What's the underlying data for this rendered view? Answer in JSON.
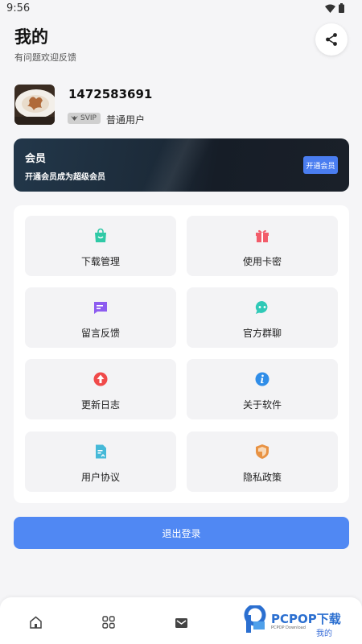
{
  "status_bar": {
    "time": "9:56"
  },
  "header": {
    "title": "我的",
    "subtitle": "有问题欢迎反馈"
  },
  "profile": {
    "username": "1472583691",
    "badge": "SVIP",
    "user_type": "普通用户"
  },
  "member": {
    "title": "会员",
    "description": "开通会员成为超级会员",
    "button_label": "开通会员"
  },
  "menu": {
    "items": [
      {
        "label": "下载管理",
        "icon": "shopping-bag-icon",
        "color": "#2fc9a6"
      },
      {
        "label": "使用卡密",
        "icon": "gift-icon",
        "color": "#f25c6a"
      },
      {
        "label": "留言反馈",
        "icon": "message-icon",
        "color": "#8d5cf0"
      },
      {
        "label": "官方群聊",
        "icon": "chat-icon",
        "color": "#2fc9b7"
      },
      {
        "label": "更新日志",
        "icon": "upgrade-icon",
        "color": "#f04a4a"
      },
      {
        "label": "关于软件",
        "icon": "info-icon",
        "color": "#2f8de8"
      },
      {
        "label": "用户协议",
        "icon": "document-icon",
        "color": "#45b9d8"
      },
      {
        "label": "隐私政策",
        "icon": "shield-icon",
        "color": "#e89243"
      }
    ]
  },
  "logout": {
    "label": "退出登录"
  },
  "bottom_nav": {
    "active_label": "我的",
    "active_color": "#3b6fd8"
  },
  "watermark": {
    "text": "PCPOP下载",
    "sub": "PCPOP Download"
  },
  "colors": {
    "primary": "#5088f3",
    "background": "#f5f5f7"
  }
}
